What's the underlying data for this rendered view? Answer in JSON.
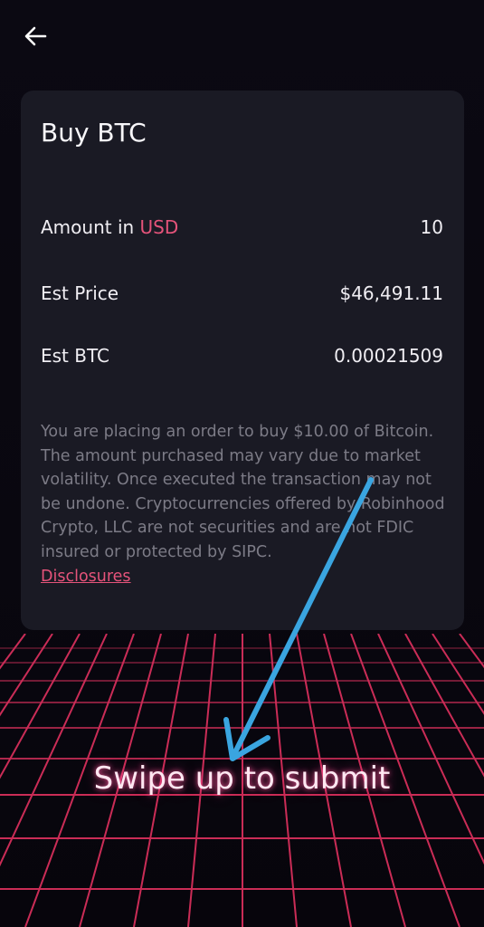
{
  "header": {
    "back_icon": "arrow-left-icon"
  },
  "card": {
    "title": "Buy BTC",
    "amount": {
      "label_prefix": "Amount in ",
      "currency": "USD",
      "value": "10"
    },
    "est_price": {
      "label": "Est Price",
      "value": "$46,491.11"
    },
    "est_btc": {
      "label": "Est BTC",
      "value": "0.00021509"
    },
    "disclaimer": "You are placing an order to buy $10.00 of Bitcoin. The amount purchased may vary due to market volatility. Once executed the transaction may not be undone. Cryptocurrencies offered by Robinhood Crypto, LLC are not securities and are not FDIC insured or protected by SIPC.",
    "disclosures_link": "Disclosures"
  },
  "swipe_label": "Swipe up to submit",
  "colors": {
    "accent": "#e5537a",
    "card_bg": "#1a1a24",
    "grid_line": "#e0315f",
    "annotation_arrow": "#3aa5e0"
  }
}
